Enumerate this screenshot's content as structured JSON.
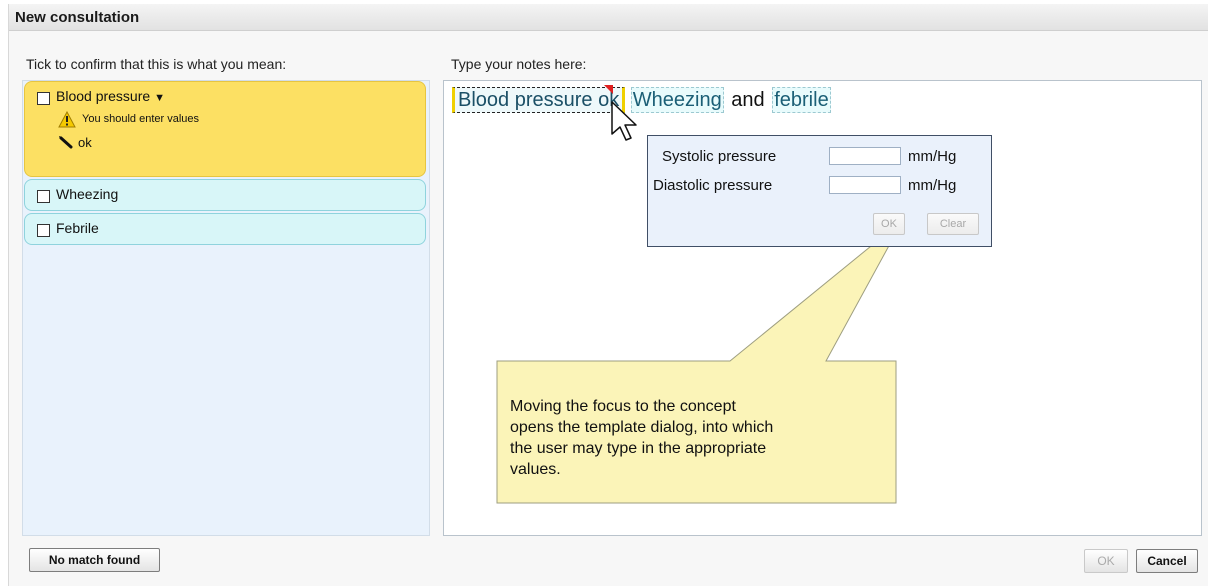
{
  "window": {
    "title": "New consultation"
  },
  "left": {
    "heading": "Tick to confirm that this is what you mean:",
    "concepts": [
      {
        "label": "Blood pressure",
        "caret": "▼",
        "warning": "You should enter values",
        "value_note": "ok"
      },
      {
        "label": "Wheezing"
      },
      {
        "label": "Febrile"
      }
    ]
  },
  "notes": {
    "heading": "Type your notes here:",
    "tokens": {
      "blood_pressure": "Blood pressure",
      "ok": "ok",
      "wheezing": "Wheezing",
      "and": "and",
      "febrile": "febrile"
    }
  },
  "template": {
    "systolic_label": "Systolic pressure",
    "systolic_unit": "mm/Hg",
    "systolic_value": "",
    "diastolic_label": "Diastolic pressure",
    "diastolic_unit": "mm/Hg",
    "diastolic_value": "",
    "ok_label": "OK",
    "clear_label": "Clear"
  },
  "callout": {
    "lines": [
      "Moving the focus to the concept",
      "opens the template dialog, into which",
      "the user may type in the appropriate",
      "values."
    ]
  },
  "footer": {
    "no_match_label": "No match found",
    "ok_label": "OK",
    "cancel_label": "Cancel"
  },
  "colors": {
    "active_concept": "#fce063",
    "concept": "#d8f6f8",
    "callout_fill": "#fbf4b8",
    "panel": "#e9f2fc"
  },
  "icons": [
    "warning-icon",
    "pencil-icon",
    "pointer-cursor-icon",
    "checkbox"
  ]
}
